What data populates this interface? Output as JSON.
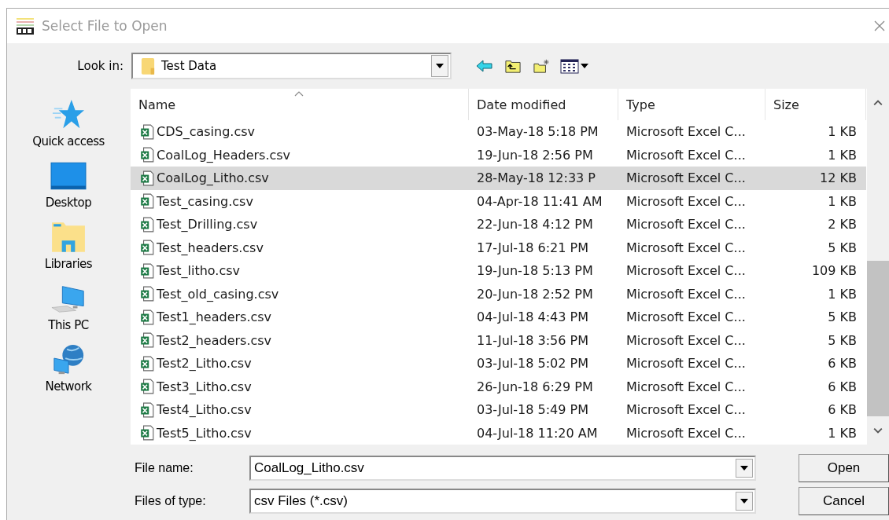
{
  "window": {
    "title": "Select File to Open"
  },
  "look_in": {
    "label": "Look in:",
    "value": "Test Data"
  },
  "places": [
    {
      "label": "Quick access",
      "kind": "star"
    },
    {
      "label": "Desktop",
      "kind": "desktop"
    },
    {
      "label": "Libraries",
      "kind": "libraries"
    },
    {
      "label": "This PC",
      "kind": "pc"
    },
    {
      "label": "Network",
      "kind": "network"
    }
  ],
  "columns": [
    "Name",
    "Date modified",
    "Type",
    "Size"
  ],
  "files": [
    {
      "name": "CDS_casing.csv",
      "date": "03-May-18 5:18 PM",
      "type": "Microsoft Excel C...",
      "size": "1 KB",
      "selected": false
    },
    {
      "name": "CoalLog_Headers.csv",
      "date": "19-Jun-18 2:56 PM",
      "type": "Microsoft Excel C...",
      "size": "1 KB",
      "selected": false
    },
    {
      "name": "CoalLog_Litho.csv",
      "date": "28-May-18 12:33 P",
      "type": "Microsoft Excel C...",
      "size": "12 KB",
      "selected": true
    },
    {
      "name": "Test_casing.csv",
      "date": "04-Apr-18 11:41 AM",
      "type": "Microsoft Excel C...",
      "size": "1 KB",
      "selected": false
    },
    {
      "name": "Test_Drilling.csv",
      "date": "22-Jun-18 4:12 PM",
      "type": "Microsoft Excel C...",
      "size": "2 KB",
      "selected": false
    },
    {
      "name": "Test_headers.csv",
      "date": "17-Jul-18 6:21 PM",
      "type": "Microsoft Excel C...",
      "size": "5 KB",
      "selected": false
    },
    {
      "name": "Test_litho.csv",
      "date": "19-Jun-18 5:13 PM",
      "type": "Microsoft Excel C...",
      "size": "109 KB",
      "selected": false
    },
    {
      "name": "Test_old_casing.csv",
      "date": "20-Jun-18 2:52 PM",
      "type": "Microsoft Excel C...",
      "size": "1 KB",
      "selected": false
    },
    {
      "name": "Test1_headers.csv",
      "date": "04-Jul-18 4:43 PM",
      "type": "Microsoft Excel C...",
      "size": "5 KB",
      "selected": false
    },
    {
      "name": "Test2_headers.csv",
      "date": "11-Jul-18 3:56 PM",
      "type": "Microsoft Excel C...",
      "size": "5 KB",
      "selected": false
    },
    {
      "name": "Test2_Litho.csv",
      "date": "03-Jul-18 5:02 PM",
      "type": "Microsoft Excel C...",
      "size": "6 KB",
      "selected": false
    },
    {
      "name": "Test3_Litho.csv",
      "date": "26-Jun-18 6:29 PM",
      "type": "Microsoft Excel C...",
      "size": "6 KB",
      "selected": false
    },
    {
      "name": "Test4_Litho.csv",
      "date": "03-Jul-18 5:49 PM",
      "type": "Microsoft Excel C...",
      "size": "6 KB",
      "selected": false
    },
    {
      "name": "Test5_Litho.csv",
      "date": "04-Jul-18 11:20 AM",
      "type": "Microsoft Excel C...",
      "size": "1 KB",
      "selected": false
    }
  ],
  "file_name": {
    "label": "File name:",
    "value": "CoalLog_Litho.csv"
  },
  "file_type": {
    "label": "Files of type:",
    "value": "csv Files (*.csv)"
  },
  "buttons": [
    "Open",
    "Cancel"
  ]
}
